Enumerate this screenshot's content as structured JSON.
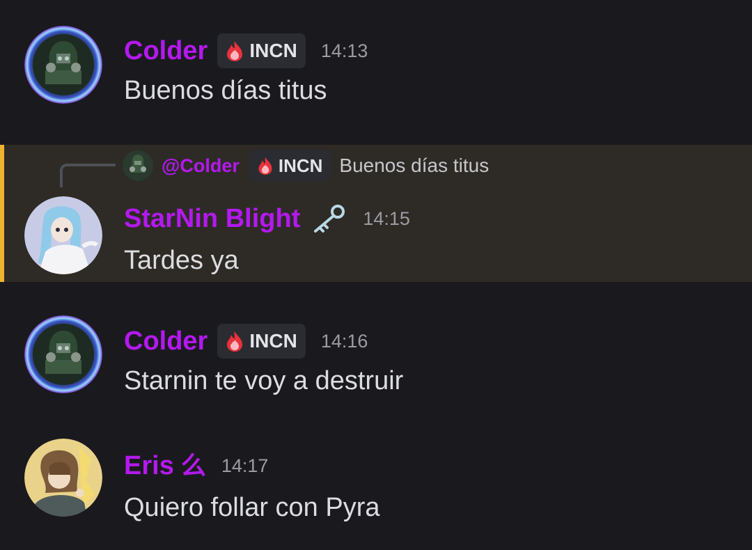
{
  "messages": [
    {
      "username": "Colder",
      "tag": "INCN",
      "time": "14:13",
      "content": "Buenos días titus"
    },
    {
      "reply": {
        "mention": "@Colder",
        "tag": "INCN",
        "text": "Buenos días titus"
      },
      "username": "StarNin Blight",
      "time": "14:15",
      "content": "Tardes ya"
    },
    {
      "username": "Colder",
      "tag": "INCN",
      "time": "14:16",
      "content": "Starnin te voy a destruir"
    },
    {
      "username": "Eris",
      "name_glyph": "么",
      "time": "14:17",
      "content": "Quiero follar con Pyra"
    }
  ],
  "colors": {
    "background": "#1a1a1e",
    "username": "#b319f0",
    "highlight_bg": "#2e2b26",
    "highlight_border": "#f0b232",
    "tag_bg": "#2b2c31"
  }
}
